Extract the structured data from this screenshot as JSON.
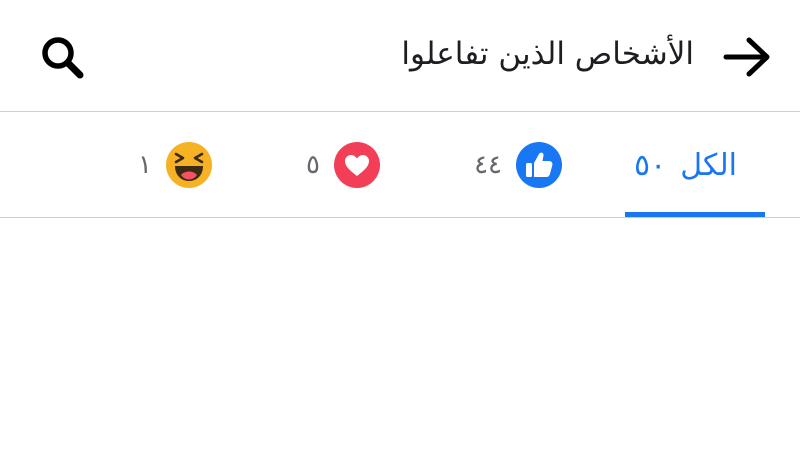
{
  "header": {
    "title": "الأشخاص الذين تفاعلوا",
    "back_icon": "arrow-right-icon",
    "search_icon": "search-icon"
  },
  "tabs": [
    {
      "key": "all",
      "label": "الكل",
      "count": "٥٠",
      "active": true
    },
    {
      "key": "like",
      "icon": "like-icon",
      "count": "٤٤",
      "active": false
    },
    {
      "key": "love",
      "icon": "love-icon",
      "count": "٥",
      "active": false
    },
    {
      "key": "haha",
      "icon": "haha-icon",
      "count": "١",
      "active": false
    }
  ],
  "colors": {
    "accent": "#1877f2",
    "like": "#1877f2",
    "love": "#f33e58",
    "haha": "#f7b125",
    "text": "#1c1e21",
    "muted": "#65676b",
    "divider": "#cfcfcf"
  }
}
